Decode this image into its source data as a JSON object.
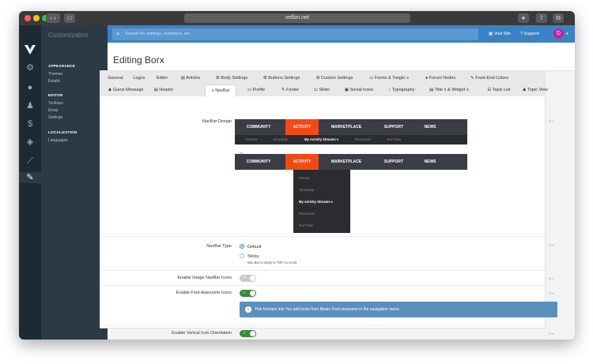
{
  "browser": {
    "url": "vellon.net"
  },
  "app": {
    "section_title": "Customization"
  },
  "sidebar": {
    "groups": [
      {
        "heading": "APPEARANCE",
        "items": [
          "Themes",
          "Emails"
        ]
      },
      {
        "heading": "EDITOR",
        "items": [
          "Toolbars",
          "Emoji",
          "Settings"
        ]
      },
      {
        "heading": "LOCALIZATION",
        "items": [
          "Languages"
        ]
      }
    ]
  },
  "topbar": {
    "search_placeholder": "Search for settings, members, etc.",
    "visit_site": "Visit Site",
    "support": "Support",
    "avatar_letter": "D"
  },
  "page": {
    "title": "Editing Borx"
  },
  "tabs": {
    "row1": [
      "General",
      "Logos",
      "Editor",
      "Articles",
      "Body Settings",
      "Buttons Settings",
      "Custom Settings",
      "Forms & Toogle´s",
      "Forum Nodes",
      "Front-End Colors"
    ],
    "row2": [
      "Guest Message",
      "Header",
      "NavBar",
      "Profile",
      "Footer",
      "Slider",
      "Social Icons",
      "Typography",
      "Title´s & Widget´s",
      "Topic List",
      "Topic View"
    ],
    "active": "NavBar"
  },
  "navbar_design": {
    "label": "NavBar Design",
    "menu": [
      "COMMUNITY",
      "ACTIVITY",
      "MARKETPLACE",
      "SUPPORT",
      "NEWS"
    ],
    "submenu": [
      "Forums",
      "All Activity",
      "My Activity Streams",
      "Resources",
      "Our Picks"
    ],
    "dropdown": [
      "Forums",
      "All Activity",
      "My Activity Streams",
      "Resources",
      "Our Picks"
    ]
  },
  "navbar_type": {
    "label": "NavBar Type",
    "options": [
      {
        "label": "Default",
        "sub": ""
      },
      {
        "label": "Sticky",
        "sub": "Nav Bar is sticky to TOP on scroll."
      }
    ]
  },
  "image_icons": {
    "label": "Enable Image NavBar Icons"
  },
  "fa_icons": {
    "label": "Enable Font-Awesome Icons",
    "info": "This function lets You add icons from library Font-awesome in the navigation menu"
  },
  "vertical_icons": {
    "label": "Enable Vertcal Icon Orientation"
  },
  "colors": {
    "accent": "#f04a16",
    "topbar": "#3b82c4",
    "toggle_on": "#3a8a3a"
  }
}
